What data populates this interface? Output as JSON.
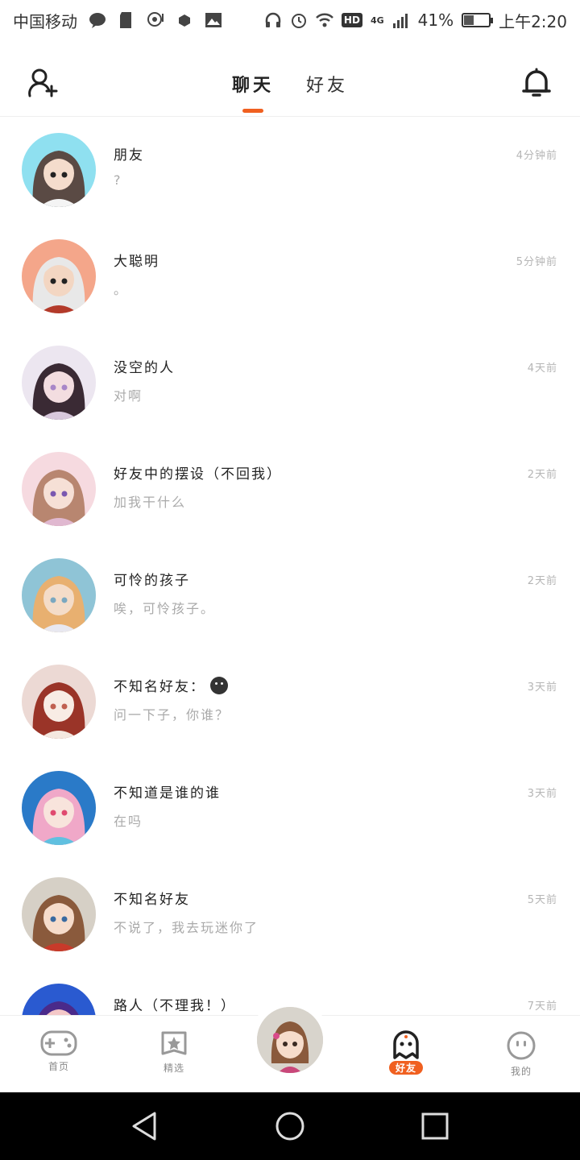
{
  "status_bar": {
    "carrier": "中国移动",
    "battery_text": "41%",
    "battery_level": 0.41,
    "hd_label": "HD",
    "network_label": "4G",
    "time": "上午2:20",
    "icons": [
      "chat-bubble-icon",
      "sd-card-icon",
      "location-icon",
      "dot-icon",
      "image-icon",
      "headphones-icon",
      "alarm-icon",
      "wifi-icon",
      "signal-icon",
      "battery-icon"
    ]
  },
  "header": {
    "tabs": [
      {
        "label": "聊天",
        "active": true
      },
      {
        "label": "好友",
        "active": false
      }
    ],
    "accent_color": "#f06020"
  },
  "chats": [
    {
      "name": "朋友",
      "message": "?",
      "time": "4分钟前"
    },
    {
      "name": "大聪明",
      "message": "。",
      "time": "5分钟前"
    },
    {
      "name": "没空的人",
      "message": "对啊",
      "time": "4天前"
    },
    {
      "name": "好友中的摆设（不回我）",
      "message": "加我干什么",
      "time": "2天前"
    },
    {
      "name": "可怜的孩子",
      "message": "唉，可怜孩子。",
      "time": "2天前"
    },
    {
      "name": "不知名好友：",
      "message": "问一下子，你谁？",
      "time": "3天前",
      "emoji": "smiley-icon"
    },
    {
      "name": "不知道是谁的谁",
      "message": "在吗",
      "time": "3天前"
    },
    {
      "name": "不知名好友",
      "message": "不说了，我去玩迷你了",
      "time": "5天前"
    },
    {
      "name": "路人（不理我！）",
      "message": "",
      "time": "7天前"
    }
  ],
  "bottom_nav": {
    "items": [
      {
        "label": "首页",
        "icon": "gamepad-icon"
      },
      {
        "label": "精选",
        "icon": "star-icon"
      },
      {
        "label": "好友",
        "icon": "ghost-icon",
        "active": true
      },
      {
        "label": "我的",
        "icon": "face-icon"
      }
    ]
  }
}
